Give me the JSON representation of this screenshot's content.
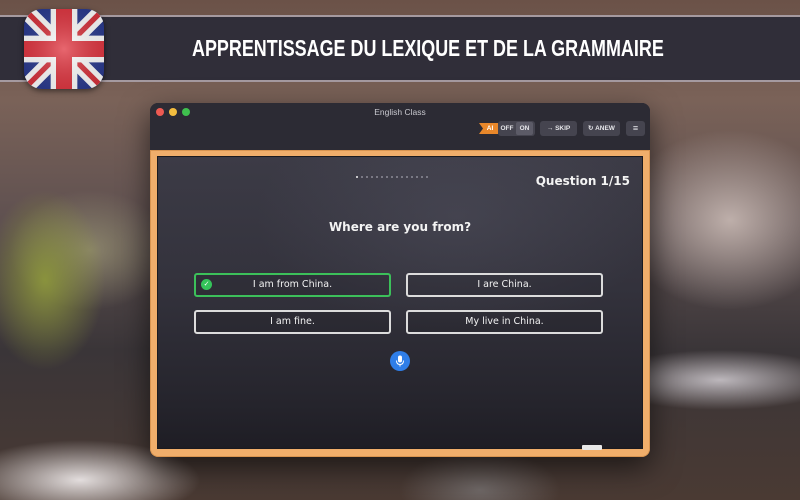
{
  "banner": {
    "title": "APPRENTISSAGE DU LEXIQUE ET DE LA GRAMMAIRE",
    "flag_icon": "uk-flag-icon"
  },
  "window": {
    "title": "English Class",
    "toolbar": {
      "ai_label": "AI",
      "toggle_off": "OFF",
      "toggle_on": "ON",
      "toggle_state": "ON",
      "skip_label": "SKIP",
      "skip_icon": "arrow-right-icon",
      "anew_label": "ANEW",
      "anew_icon": "refresh-icon",
      "menu_icon": "hamburger-menu-icon"
    }
  },
  "quiz": {
    "progress": {
      "current": 1,
      "total": 15
    },
    "question_label": "Question 1/15",
    "question": "Where are you from?",
    "answers": [
      {
        "text": "I am from China.",
        "state": "correct"
      },
      {
        "text": "I are China.",
        "state": "default"
      },
      {
        "text": "I am fine.",
        "state": "default"
      },
      {
        "text": "My live in China.",
        "state": "default"
      }
    ],
    "mic_icon": "microphone-icon"
  },
  "colors": {
    "accent_ai": "#e8872a",
    "correct": "#3cc05a",
    "mic": "#2f7ee8",
    "frame": "#f0ae6b",
    "board": "#33323c"
  }
}
